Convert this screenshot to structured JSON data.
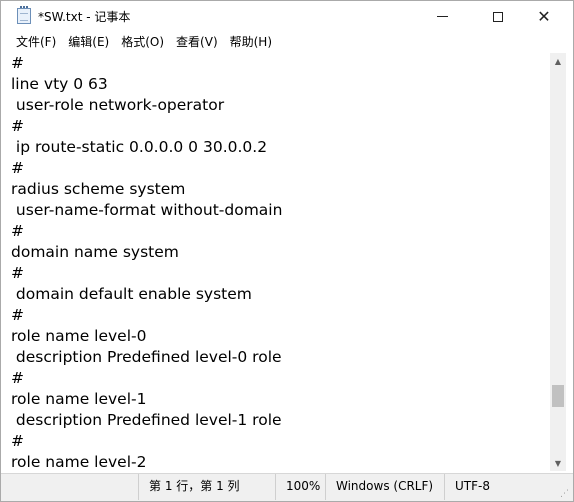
{
  "window": {
    "title": "*SW.txt - 记事本"
  },
  "menu": [
    "文件(F)",
    "编辑(E)",
    "格式(O)",
    "查看(V)",
    "帮助(H)"
  ],
  "editor": {
    "lines": [
      "#",
      "line vty 0 63",
      " user-role network-operator",
      "#",
      " ip route-static 0.0.0.0 0 30.0.0.2",
      "#",
      "radius scheme system",
      " user-name-format without-domain",
      "#",
      "domain name system",
      "#",
      " domain default enable system",
      "#",
      "role name level-0",
      " description Predefined level-0 role",
      "#",
      "role name level-1",
      " description Predefined level-1 role",
      "#",
      "role name level-2"
    ]
  },
  "status": {
    "position": "第 1 行，第 1 列",
    "zoom": "100%",
    "line_ending": "Windows (CRLF)",
    "encoding": "UTF-8"
  }
}
